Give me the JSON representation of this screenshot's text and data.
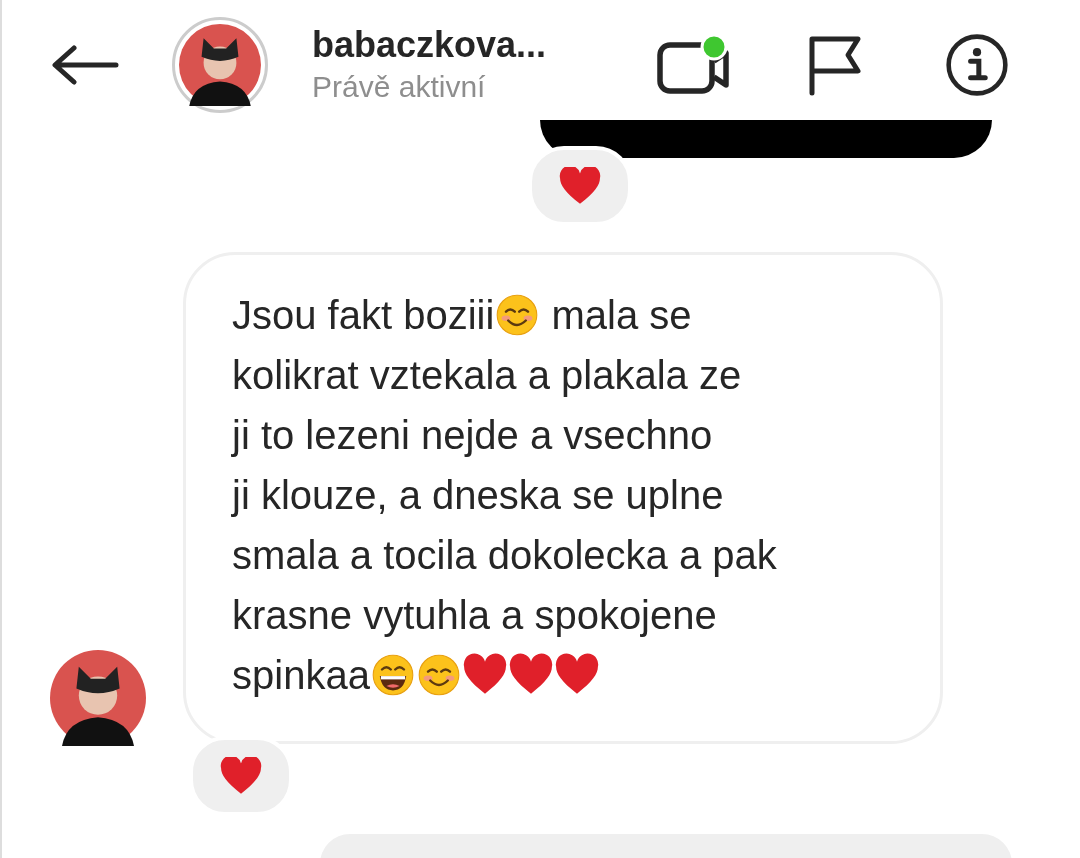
{
  "header": {
    "name": "babaczkova...",
    "status": "Právě aktivní",
    "video_call_active": true
  },
  "previous_message": {
    "reaction": {
      "kind": "heart"
    }
  },
  "message": {
    "lines": [
      [
        {
          "kind": "text",
          "text": "Jsou fakt boziii"
        },
        {
          "kind": "smiling-face"
        },
        {
          "kind": "text",
          "text": " mala se"
        }
      ],
      [
        {
          "kind": "text",
          "text": "kolikrat vztekala a plakala ze"
        }
      ],
      [
        {
          "kind": "text",
          "text": "ji to lezeni nejde a vsechno"
        }
      ],
      [
        {
          "kind": "text",
          "text": "ji klouze, a dneska se uplne"
        }
      ],
      [
        {
          "kind": "text",
          "text": "smala a tocila dokolecka a pak"
        }
      ],
      [
        {
          "kind": "text",
          "text": "krasne vytuhla a spokojene"
        }
      ],
      [
        {
          "kind": "text",
          "text": "spinkaa"
        },
        {
          "kind": "grinning-face"
        },
        {
          "kind": "smiling-face"
        },
        {
          "kind": "heart"
        },
        {
          "kind": "heart"
        },
        {
          "kind": "heart"
        }
      ]
    ],
    "reaction": {
      "kind": "heart"
    }
  }
}
